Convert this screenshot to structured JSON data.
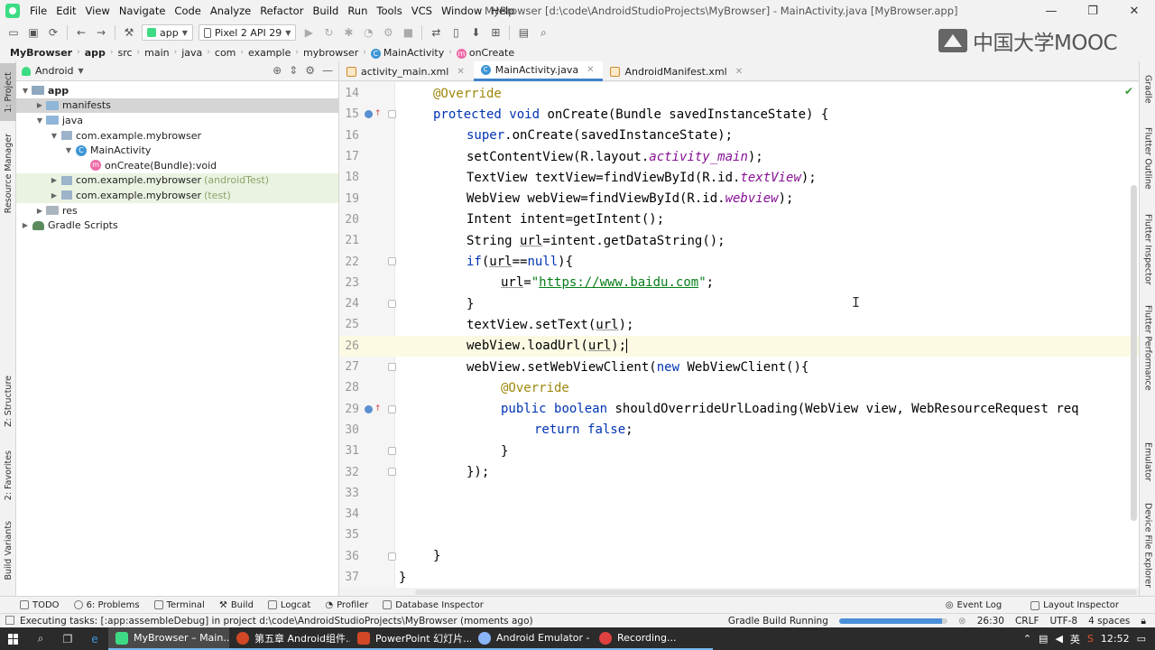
{
  "menubar": {
    "items": [
      "File",
      "Edit",
      "View",
      "Navigate",
      "Code",
      "Analyze",
      "Refactor",
      "Build",
      "Run",
      "Tools",
      "VCS",
      "Window",
      "Help"
    ],
    "title": "MyBrowser [d:\\code\\AndroidStudioProjects\\MyBrowser] - MainActivity.java [MyBrowser.app]"
  },
  "toolbar": {
    "module": "app",
    "device": "Pixel 2 API 29"
  },
  "watermark": "中国大学MOOC",
  "breadcrumb": [
    "MyBrowser",
    "app",
    "src",
    "main",
    "java",
    "com",
    "example",
    "mybrowser",
    "MainActivity",
    "onCreate"
  ],
  "left_strip": {
    "project": "1: Project",
    "resource": "Resource Manager",
    "structure": "Z: Structure",
    "favorites": "2: Favorites",
    "variants": "Build Variants"
  },
  "right_strip": {
    "gradle": "Gradle",
    "flutter_outline": "Flutter Outline",
    "flutter_inspector": "Flutter Inspector",
    "flutter_perf": "Flutter Performance",
    "emulator": "Emulator",
    "device_explorer": "Device File Explorer"
  },
  "project_panel": {
    "view": "Android",
    "tree": [
      {
        "label": "app"
      },
      {
        "label": "manifests"
      },
      {
        "label": "java"
      },
      {
        "label": "com.example.mybrowser"
      },
      {
        "label": "MainActivity"
      },
      {
        "label": "onCreate(Bundle):void"
      },
      {
        "label": "com.example.mybrowser",
        "suffix": "(androidTest)"
      },
      {
        "label": "com.example.mybrowser",
        "suffix": "(test)"
      },
      {
        "label": "res"
      },
      {
        "label": "Gradle Scripts"
      }
    ]
  },
  "tabs": [
    "activity_main.xml",
    "MainActivity.java",
    "AndroidManifest.xml"
  ],
  "editor": {
    "line_numbers": [
      "14",
      "15",
      "16",
      "17",
      "18",
      "19",
      "20",
      "21",
      "22",
      "23",
      "24",
      "25",
      "26",
      "27",
      "28",
      "29",
      "30",
      "31",
      "32",
      "33",
      "34",
      "35",
      "36",
      "37"
    ],
    "lines": [
      {
        "p": [
          "@Override"
        ]
      },
      {
        "p": [
          "protected",
          " ",
          "void",
          " onCreate(Bundle savedInstanceState) {"
        ]
      },
      {
        "p": [
          "super",
          ".onCreate(savedInstanceState);"
        ]
      },
      {
        "p": [
          "setContentView(R.layout.",
          "activity_main",
          ");"
        ]
      },
      {
        "p": [
          "TextView textView=findViewById(R.id.",
          "textView",
          ");"
        ]
      },
      {
        "p": [
          "WebView webView=findViewById(R.id.",
          "webview",
          ");"
        ]
      },
      {
        "p": [
          "Intent intent=getIntent();"
        ]
      },
      {
        "p": [
          "String ",
          "url",
          "=intent.getDataString();"
        ]
      },
      {
        "p": [
          "if",
          "(",
          "url",
          "==",
          "null",
          "){"
        ]
      },
      {
        "p": [
          "url",
          "=",
          "\"",
          "https://www.baidu.com",
          "\"",
          ";"
        ]
      },
      {
        "p": [
          "}"
        ]
      },
      {
        "p": [
          "textView.setText(",
          "url",
          ");"
        ]
      },
      {
        "p": [
          "webView.loadUrl(",
          "url",
          ");"
        ]
      },
      {
        "p": [
          "webView.setWebViewClient(",
          "new",
          " WebViewClient(){"
        ]
      },
      {
        "p": [
          "@Override"
        ]
      },
      {
        "p": [
          "public",
          " ",
          "boolean",
          " shouldOverrideUrlLoading(WebView view, WebResourceRequest req"
        ]
      },
      {
        "p": [
          "return",
          " ",
          "false",
          ";"
        ]
      },
      {
        "p": [
          "}"
        ]
      },
      {
        "p": [
          "});"
        ]
      },
      {
        "p": []
      },
      {
        "p": []
      },
      {
        "p": []
      },
      {
        "p": [
          "}"
        ]
      },
      {
        "p": [
          "}"
        ]
      }
    ]
  },
  "bottom_tabs": [
    "TODO",
    "6: Problems",
    "Terminal",
    "Build",
    "Logcat",
    "Profiler",
    "Database Inspector"
  ],
  "bottom_right": [
    "Event Log",
    "Layout Inspector"
  ],
  "status": {
    "message": "Executing tasks: [:app:assembleDebug] in project d:\\code\\AndroidStudioProjects\\MyBrowser (moments ago)",
    "task": "Gradle Build Running",
    "progress": 0.95,
    "position": "26:30",
    "line_sep": "CRLF",
    "encoding": "UTF-8",
    "indent": "4 spaces"
  },
  "taskbar": {
    "apps": [
      "MyBrowser – Main...",
      "第五章 Android组件...",
      "PowerPoint 幻灯片...",
      "Android Emulator - ...",
      "Recording..."
    ],
    "ime": "英",
    "time": "12:52"
  },
  "colors": {
    "accent": "#4083c9",
    "keyword": "#0033b3",
    "annotation": "#9e880d",
    "string": "#067d17",
    "field": "#871094"
  }
}
